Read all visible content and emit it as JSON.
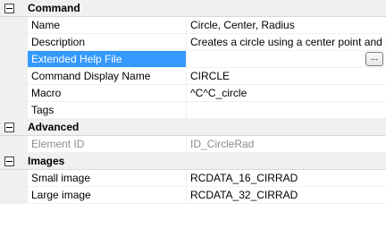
{
  "categories": {
    "command": {
      "label": "Command",
      "rows": {
        "name": {
          "label": "Name",
          "value": "Circle, Center, Radius"
        },
        "description": {
          "label": "Description",
          "value": "Creates a circle using a center point and radius"
        },
        "extended_help_file": {
          "label": "Extended Help File",
          "value": "",
          "button_label": "..."
        },
        "display_name": {
          "label": "Command Display Name",
          "value": "CIRCLE"
        },
        "macro": {
          "label": "Macro",
          "value": "^C^C_circle"
        },
        "tags": {
          "label": "Tags",
          "value": ""
        }
      }
    },
    "advanced": {
      "label": "Advanced",
      "rows": {
        "element_id": {
          "label": "Element ID",
          "value": "ID_CircleRad"
        }
      }
    },
    "images": {
      "label": "Images",
      "rows": {
        "small_image": {
          "label": "Small image",
          "value": "RCDATA_16_CIRRAD"
        },
        "large_image": {
          "label": "Large image",
          "value": "RCDATA_32_CIRRAD"
        }
      }
    }
  },
  "colors": {
    "selection": "#3399ff",
    "category_background": "#f0f0f0",
    "disabled_text": "#8c8c8c"
  },
  "icons": {
    "category_toggle": "minus-box-icon"
  }
}
